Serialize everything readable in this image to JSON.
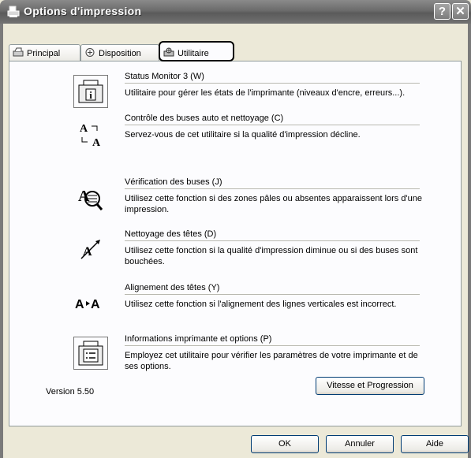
{
  "window": {
    "title": "Options d'impression",
    "help_button": "?",
    "close_button": "✕"
  },
  "tabs": [
    {
      "label": "Principal"
    },
    {
      "label": "Disposition"
    },
    {
      "label": "Utilitaire"
    }
  ],
  "utilities": [
    {
      "name": "Status Monitor 3 (W)",
      "description": "Utilitaire pour gérer les états de l'imprimante (niveaux d'encre, erreurs...).",
      "icon": "status-monitor-icon"
    },
    {
      "name": "Contrôle des buses auto et nettoyage (C)",
      "description": "Servez-vous de cet utilitaire si la qualité d'impression décline.",
      "icon": "auto-nozzle-icon"
    },
    {
      "name": "Vérification des buses (J)",
      "description": "Utilisez cette fonction si des zones pâles ou absentes apparaissent lors d'une impression.",
      "icon": "nozzle-check-icon"
    },
    {
      "name": "Nettoyage des têtes (D)",
      "description": "Utilisez cette fonction si la qualité d'impression diminue ou si des buses sont bouchées.",
      "icon": "head-cleaning-icon"
    },
    {
      "name": "Alignement des têtes (Y)",
      "description": "Utilisez cette fonction si l'alignement des lignes verticales est incorrect.",
      "icon": "head-alignment-icon"
    },
    {
      "name": "Informations imprimante et options (P)",
      "description": "Employez cet utilitaire pour vérifier les paramètres de votre imprimante et de ses options.",
      "icon": "printer-info-icon"
    }
  ],
  "version": "Version 5.50",
  "speed_button": "Vitesse et Progression",
  "buttons": {
    "ok": "OK",
    "cancel": "Annuler",
    "help": "Aide"
  }
}
